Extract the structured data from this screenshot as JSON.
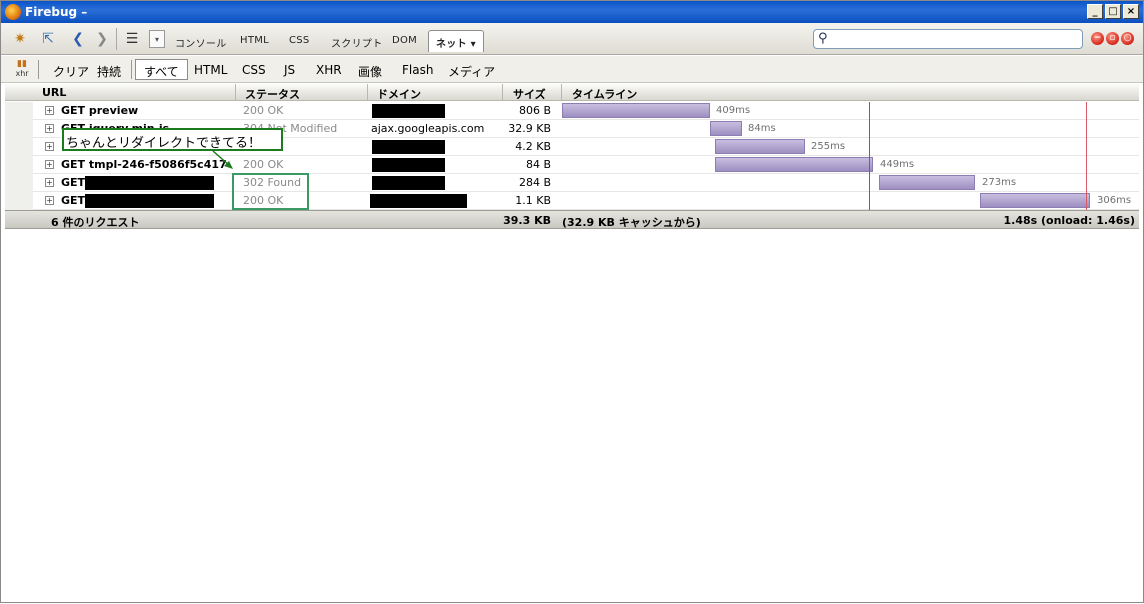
{
  "window": {
    "title": "Firebug – ",
    "controls": [
      "_",
      "□",
      "×"
    ]
  },
  "toolbar": {
    "panels": [
      "コンソール",
      "HTML",
      "CSS",
      "スクリプト",
      "DOM"
    ],
    "active_panel": "ネット ▾",
    "search": {
      "value": "",
      "placeholder": ""
    }
  },
  "filterbar": {
    "clear": "クリア",
    "persist": "持続",
    "filters": [
      "すべて",
      "HTML",
      "CSS",
      "JS",
      "XHR",
      "画像",
      "Flash",
      "メディア"
    ],
    "active_filter": "すべて"
  },
  "columns": {
    "url": "URL",
    "status": "ステータス",
    "domain": "ドメイン",
    "size": "サイズ",
    "timeline": "タイムライン"
  },
  "requests": [
    {
      "url": "GET preview",
      "status": "200 OK",
      "domain": "",
      "size": "806 B",
      "time": "409ms"
    },
    {
      "url": "GET jquery.min.js",
      "status": "304 Not Modified",
      "domain": "ajax.googleapis.com",
      "size": "32.9 KB",
      "time": "84ms"
    },
    {
      "url": "",
      "status": "",
      "domain": "",
      "size": "4.2 KB",
      "time": "255ms"
    },
    {
      "url": "GET tmpl-246-f5086f5c417",
      "status": "200 OK",
      "domain": "",
      "size": "84 B",
      "time": "449ms"
    },
    {
      "url": "GET",
      "status": "302 Found",
      "domain": "",
      "size": "284 B",
      "time": "273ms"
    },
    {
      "url": "GET",
      "status": "200 OK",
      "domain": "",
      "size": "1.1 KB",
      "time": "306ms"
    }
  ],
  "summary": {
    "count": "6 件のリクエスト",
    "total": "39.3 KB",
    "cache": "(32.9 KB キャッシュから)",
    "timing": "1.48s (onload: 1.46s)"
  },
  "annotation": {
    "text": "ちゃんとリダイレクトできてる！",
    "color": "#1e7a1e"
  }
}
